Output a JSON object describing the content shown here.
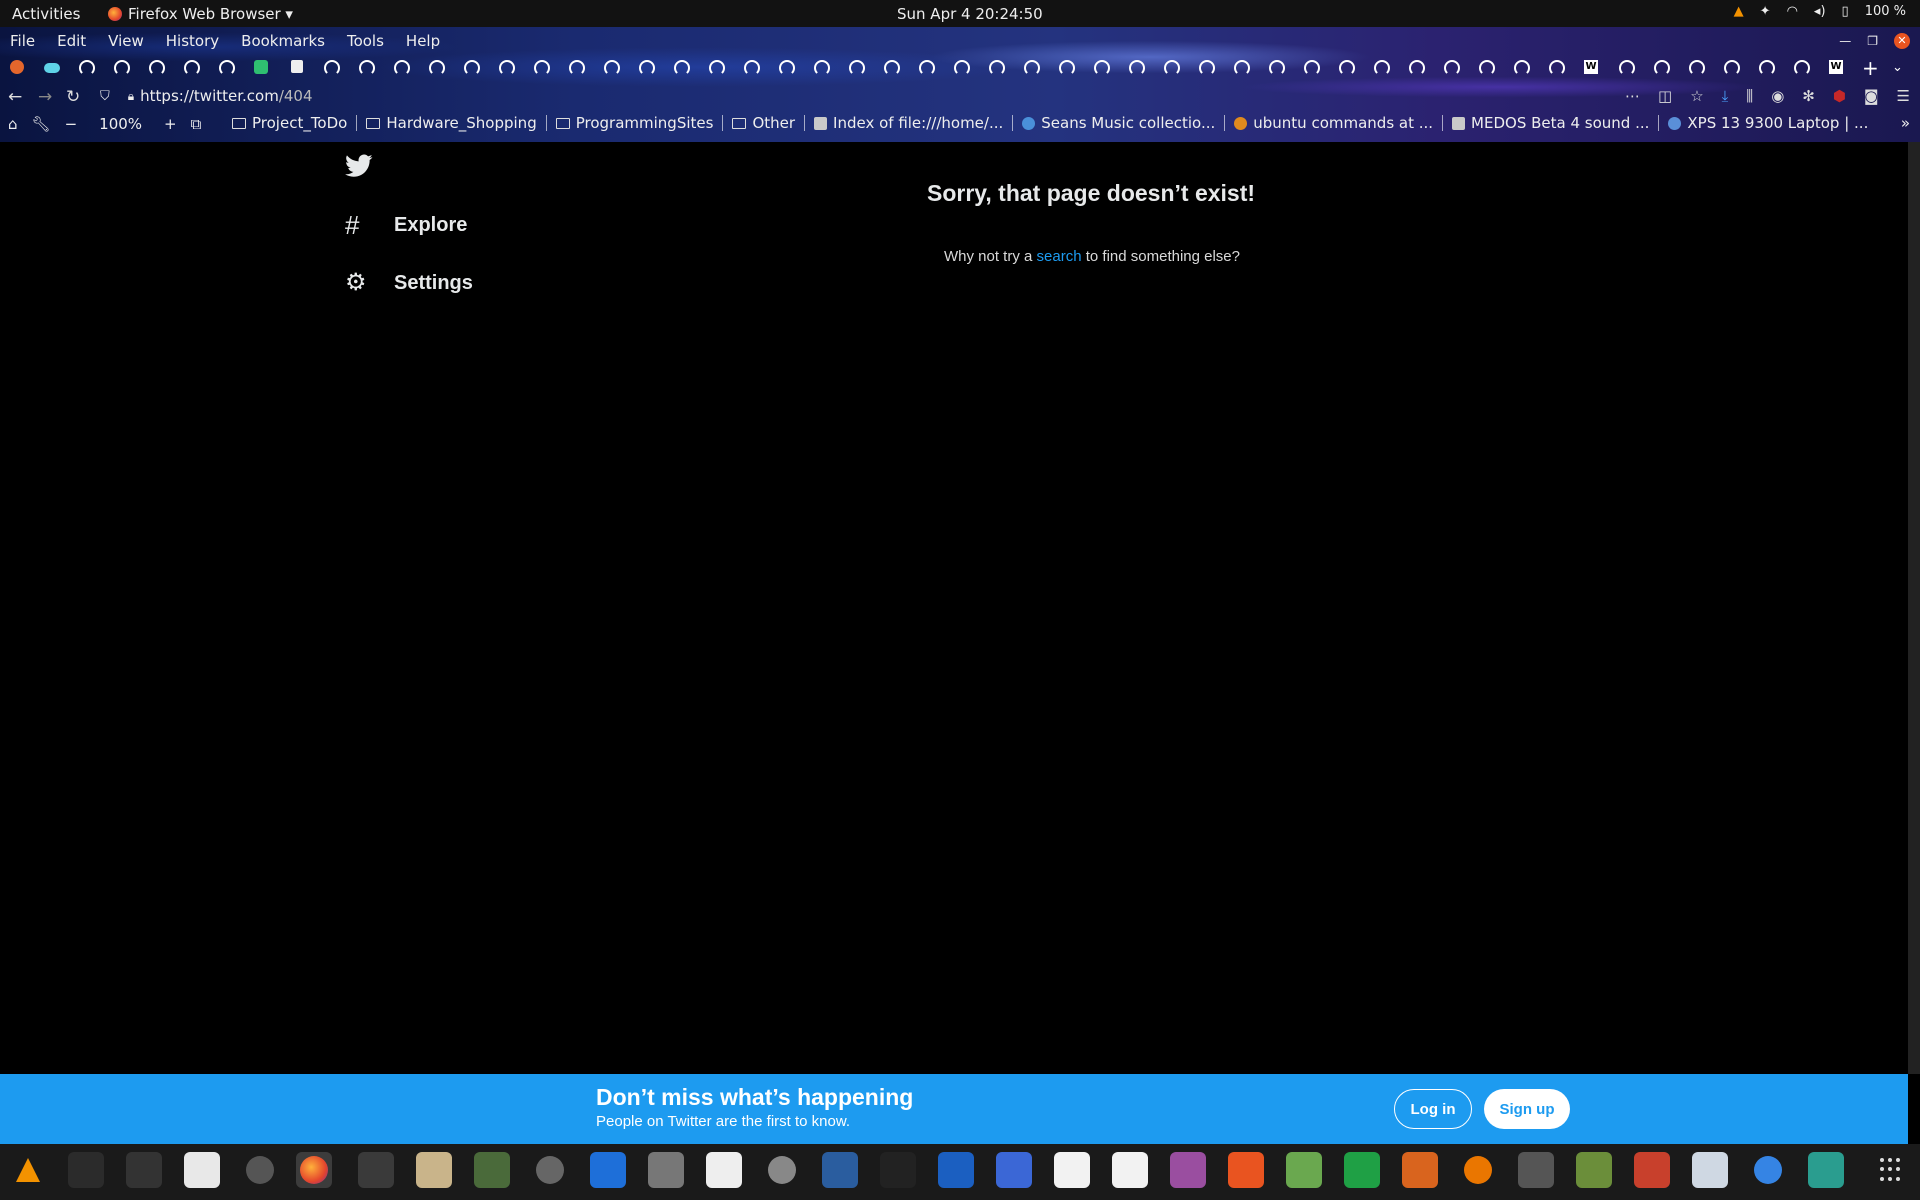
{
  "topbar": {
    "activities": "Activities",
    "app_name": "Firefox Web Browser ▾",
    "clock": "Sun Apr 4  20:24:50",
    "battery": "100 %"
  },
  "menubar": [
    "File",
    "Edit",
    "View",
    "History",
    "Bookmarks",
    "Tools",
    "Help"
  ],
  "navbar": {
    "url_host": "https://twitter.com",
    "url_path": "/404"
  },
  "bookmarks_bar": {
    "zoom": "100%",
    "items": [
      {
        "label": "Project_ToDo",
        "icon": "folder-icon"
      },
      {
        "label": "Hardware_Shopping",
        "icon": "folder-icon"
      },
      {
        "label": "ProgrammingSites",
        "icon": "folder-icon"
      },
      {
        "label": "Other",
        "icon": "folder-icon"
      },
      {
        "label": "Index of file:///home/...",
        "icon": "page-icon"
      },
      {
        "label": "Seans Music collectio...",
        "icon": "globe-icon"
      },
      {
        "label": "ubuntu commands at ...",
        "icon": "site-icon"
      },
      {
        "label": "MEDOS Beta 4 sound ...",
        "icon": "site-icon"
      },
      {
        "label": "XPS 13 9300 Laptop | ...",
        "icon": "site-icon"
      }
    ]
  },
  "sidebar": {
    "items": [
      {
        "label": "Explore",
        "icon": "hashtag-icon"
      },
      {
        "label": "Settings",
        "icon": "gear-icon"
      }
    ]
  },
  "error": {
    "title": "Sorry, that page doesn’t exist!",
    "body_prefix": "Why not try a ",
    "link": "search",
    "body_suffix": " to find something else?"
  },
  "banner": {
    "headline": "Don’t miss what’s happening",
    "subtext": "People on Twitter are the first to know.",
    "login": "Log in",
    "signup": "Sign up"
  },
  "colors": {
    "twitter_blue": "#1d9bf0",
    "page_bg": "#000000",
    "text": "#e7e9ea"
  }
}
